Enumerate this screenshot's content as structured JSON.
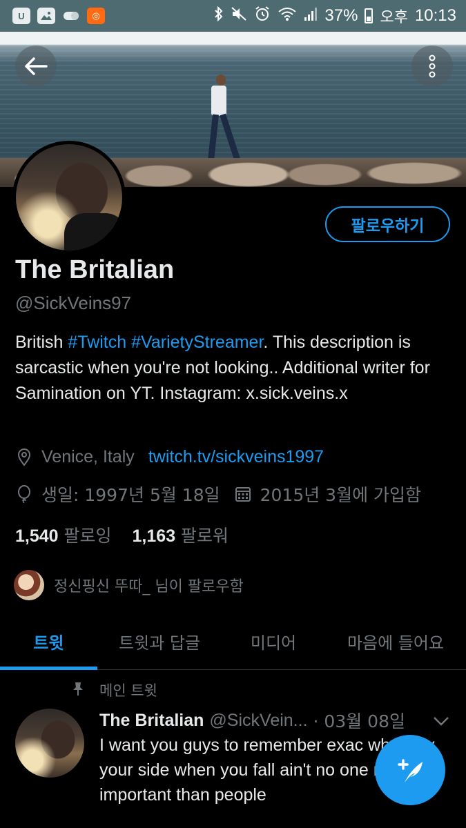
{
  "status_bar": {
    "battery": "37%",
    "ampm": "오후",
    "time": "10:13",
    "left_icons": [
      "app-icon",
      "gallery-icon",
      "pill-icon",
      "orange-app-icon"
    ],
    "right_icons": [
      "bluetooth-icon",
      "mute-icon",
      "alarm-icon",
      "wifi-icon",
      "signal-icon",
      "battery-icon"
    ]
  },
  "profile": {
    "name": "The Britalian",
    "handle": "@SickVeins97",
    "follow_label": "팔로우하기",
    "bio": {
      "t1": "British ",
      "tag1": "#Twitch",
      "t2": " ",
      "tag2": "#VarietyStreamer",
      "t3": ". This description is sarcastic when you're not looking.. Additional writer for Samination on YT. Instagram: x.sick.veins.x"
    },
    "location": "Venice, Italy",
    "website": "twitch.tv/sickveins1997",
    "birthday": "생일: 1997년 5월 18일",
    "joined": "2015년 3월에 가입함",
    "following_count": "1,540",
    "following_label": "팔로잉",
    "followers_count": "1,163",
    "followers_label": "팔로워",
    "followed_by": "정신핑신 뚜따_ 님이 팔로우함"
  },
  "tabs": [
    {
      "label": "트윗"
    },
    {
      "label": "트윗과 답글"
    },
    {
      "label": "미디어"
    },
    {
      "label": "마음에 들어요"
    }
  ],
  "tweet": {
    "pinned_label": "메인 트윗",
    "name": "The Britalian",
    "handle": "@SickVein...",
    "date": "· 03월 08일",
    "text": "I want you guys to remember exac who's by your side when you fall ain't no one more important than people"
  },
  "colors": {
    "accent": "#1d9bf0",
    "status_bar": "#4f6b72",
    "background": "#000000"
  }
}
